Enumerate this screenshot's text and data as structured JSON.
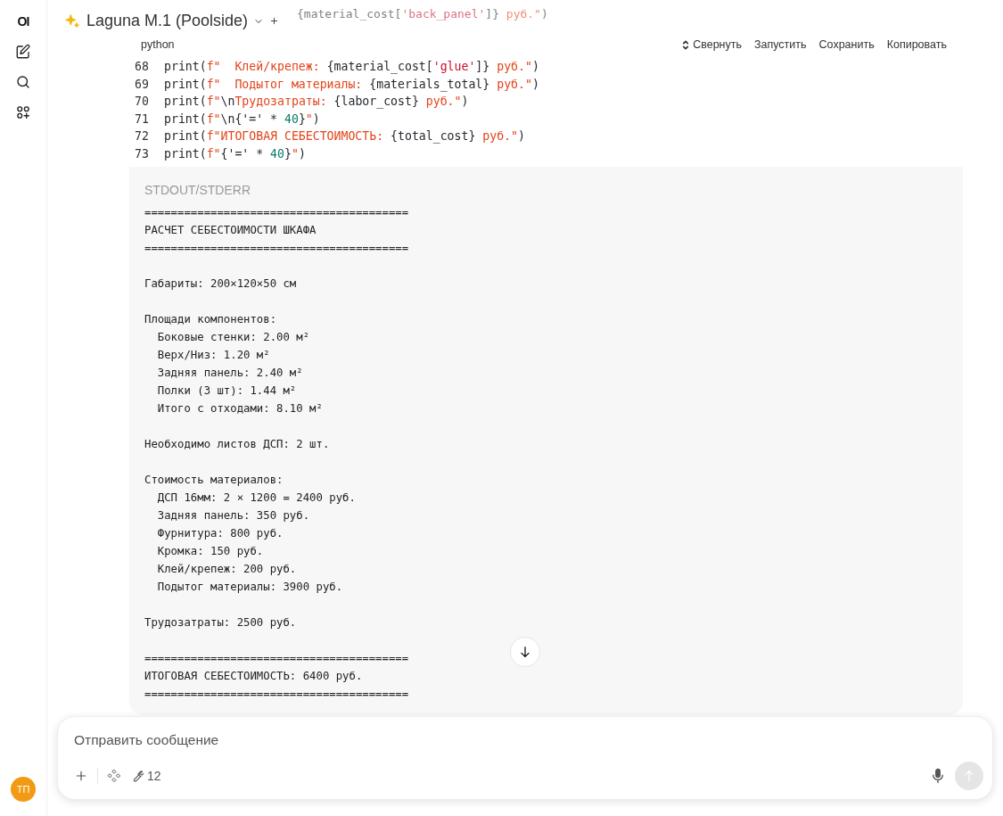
{
  "sidebar": {
    "logo": "OI",
    "avatar": "ТП"
  },
  "header": {
    "model": "Laguna M.1 (Poolside)"
  },
  "scrolled_code": [
    {
      "tokens": [
        {
          "t": "{material_cost[",
          "kind": "plain"
        },
        {
          "t": "'back_panel'",
          "kind": "key"
        },
        {
          "t": "]}",
          "kind": "plain"
        },
        {
          "t": " руб.\"",
          "kind": "str"
        },
        {
          "t": ")",
          "kind": "plain"
        }
      ]
    }
  ],
  "code_block": {
    "language": "python",
    "actions": [
      "Свернуть",
      "Запустить",
      "Сохранить",
      "Копировать"
    ],
    "lines": [
      {
        "number": "68",
        "tokens": [
          {
            "t": "print(",
            "kind": "plain"
          },
          {
            "t": "f\"  Клей/крепеж: ",
            "kind": "str"
          },
          {
            "t": "{material_cost[",
            "kind": "plain"
          },
          {
            "t": "'glue'",
            "kind": "key"
          },
          {
            "t": "]}",
            "kind": "plain"
          },
          {
            "t": " руб.\"",
            "kind": "str"
          },
          {
            "t": ")",
            "kind": "plain"
          }
        ]
      },
      {
        "number": "69",
        "tokens": [
          {
            "t": "print(",
            "kind": "plain"
          },
          {
            "t": "f\"  Подытог материалы: ",
            "kind": "str"
          },
          {
            "t": "{materials_total}",
            "kind": "plain"
          },
          {
            "t": " руб.\"",
            "kind": "str"
          },
          {
            "t": ")",
            "kind": "plain"
          }
        ]
      },
      {
        "number": "70",
        "tokens": [
          {
            "t": "print(",
            "kind": "plain"
          },
          {
            "t": "f\"",
            "kind": "str"
          },
          {
            "t": "\\n",
            "kind": "escape"
          },
          {
            "t": "Трудозатраты: ",
            "kind": "str"
          },
          {
            "t": "{labor_cost}",
            "kind": "plain"
          },
          {
            "t": " руб.\"",
            "kind": "str"
          },
          {
            "t": ")",
            "kind": "plain"
          }
        ]
      },
      {
        "number": "71",
        "tokens": [
          {
            "t": "print(",
            "kind": "plain"
          },
          {
            "t": "f\"",
            "kind": "str"
          },
          {
            "t": "\\n",
            "kind": "escape"
          },
          {
            "t": "{'=' * ",
            "kind": "plain"
          },
          {
            "t": "40",
            "kind": "num"
          },
          {
            "t": "}",
            "kind": "plain"
          },
          {
            "t": "\"",
            "kind": "str"
          },
          {
            "t": ")",
            "kind": "plain"
          }
        ]
      },
      {
        "number": "72",
        "tokens": [
          {
            "t": "print(",
            "kind": "plain"
          },
          {
            "t": "f\"ИТОГОВАЯ СЕБЕСТОИМОСТЬ: ",
            "kind": "str"
          },
          {
            "t": "{total_cost}",
            "kind": "plain"
          },
          {
            "t": " руб.\"",
            "kind": "str"
          },
          {
            "t": ")",
            "kind": "plain"
          }
        ]
      },
      {
        "number": "73",
        "tokens": [
          {
            "t": "print(",
            "kind": "plain"
          },
          {
            "t": "f\"",
            "kind": "str"
          },
          {
            "t": "{'=' * ",
            "kind": "plain"
          },
          {
            "t": "40",
            "kind": "num"
          },
          {
            "t": "}",
            "kind": "plain"
          },
          {
            "t": "\"",
            "kind": "str"
          },
          {
            "t": ")",
            "kind": "plain"
          }
        ]
      }
    ]
  },
  "output": {
    "label": "STDOUT/STDERR",
    "text": "========================================\nРАСЧЕТ СЕБЕСТОИМОСТИ ШКАФА\n========================================\n\nГабариты: 200×120×50 см\n\nПлощади компонентов:\n  Боковые стенки: 2.00 м²\n  Верх/Низ: 1.20 м²\n  Задняя панель: 2.40 м²\n  Полки (3 шт): 1.44 м²\n  Итого с отходами: 8.10 м²\n\nНеобходимо листов ДСП: 2 шт.\n\nСтоимость материалов:\n  ДСП 16мм: 2 × 1200 = 2400 руб.\n  Задняя панель: 350 руб.\n  Фурнитура: 800 руб.\n  Кромка: 150 руб.\n  Клей/крепеж: 200 руб.\n  Подытог материалы: 3900 руб.\n\nТрудозатраты: 2500 руб.\n\n========================================\nИТОГОВАЯ СЕБЕСТОИМОСТЬ: 6400 руб.\n========================================"
  },
  "composer": {
    "placeholder": "Отправить сообщение",
    "tools_count": "12",
    "send_disabled": true
  }
}
